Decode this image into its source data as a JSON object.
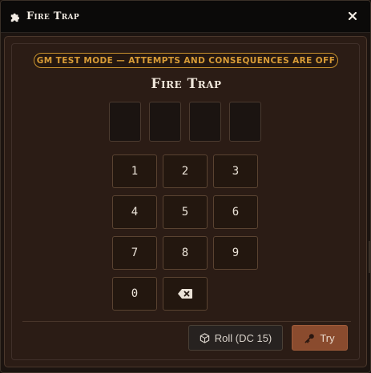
{
  "window": {
    "title": "Fire Trap",
    "title_icon": "puzzle-piece-icon",
    "close_icon": "close-icon"
  },
  "panel": {
    "gm_notice": "GM TEST MODE — ATTEMPTS AND CONSEQUENCES ARE OFF",
    "trap_title": "Fire Trap",
    "code_slots": [
      "",
      "",
      "",
      ""
    ],
    "keys": [
      "1",
      "2",
      "3",
      "4",
      "5",
      "6",
      "7",
      "8",
      "9",
      "0"
    ],
    "backspace_icon": "backspace-icon"
  },
  "actions": {
    "roll_label": "Roll (DC 15)",
    "roll_icon": "dice-icon",
    "try_label": "Try",
    "try_icon": "key-icon"
  },
  "colors": {
    "accent_gold": "#d79b36",
    "try_button": "#8a4b2e",
    "panel_bg": "#2b1c15"
  }
}
